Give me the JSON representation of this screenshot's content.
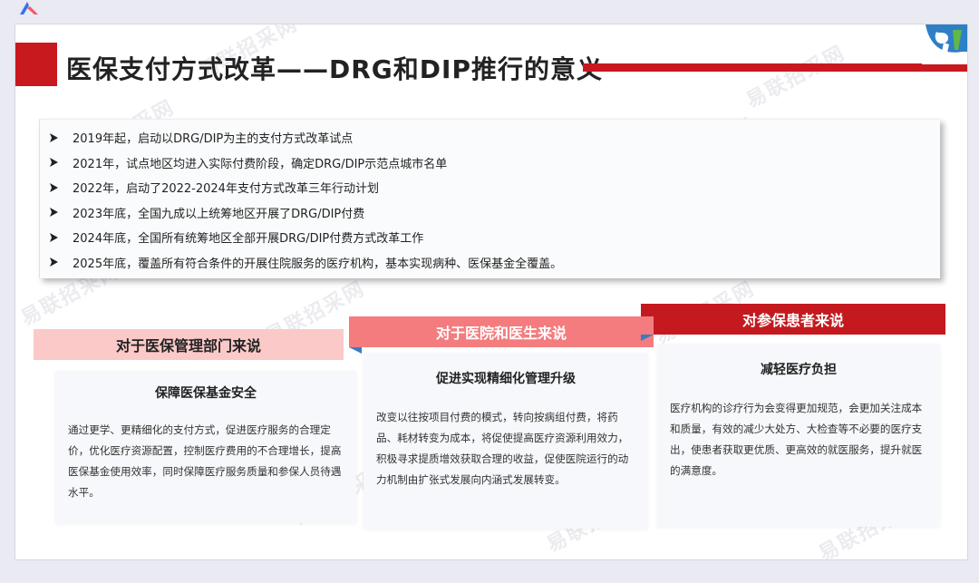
{
  "slide": {
    "title": "医保支付方式改革——DRG和DIP推行的意义",
    "watermark": "易联招采网"
  },
  "timeline": [
    "2019年起，启动以DRG/DIP为主的支付方式改革试点",
    "2021年，试点地区均进入实际付费阶段，确定DRG/DIP示范点城市名单",
    "2022年，启动了2022-2024年支付方式改革三年行动计划",
    "2023年底，全国九成以上统筹地区开展了DRG/DIP付费",
    "2024年底，全国所有统筹地区全部开展DRG/DIP付费方式改革工作",
    "2025年底，覆盖所有符合条件的开展住院服务的医疗机构，基本实现病种、医保基金全覆盖。"
  ],
  "columns": [
    {
      "header": "对于医保管理部门来说",
      "card_title": "保障医保基金安全",
      "card_body": "通过更学、更精细化的支付方式，促进医疗服务的合理定价，优化医疗资源配置，控制医疗费用的不合理增长，提高医保基金使用效率，同时保障医疗服务质量和参保人员待遇水平。"
    },
    {
      "header": "对于医院和医生来说",
      "card_title": "促进实现精细化管理升级",
      "card_body": "改变以往按项目付费的模式，转向按病组付费，将药品、耗材转变为成本，将促使提高医疗资源利用效力，积极寻求提质增效获取合理的收益，促使医院运行的动力机制由扩张式发展向内涵式发展转变。"
    },
    {
      "header": "对参保患者来说",
      "card_title": "减轻医疗负担",
      "card_body": "医疗机构的诊疗行为会变得更加规范，会更加关注成本和质量，有效的减少大处方、大检查等不必要的医疗支出，使患者获取更优质、更高效的就医服务，提升就医的满意度。"
    }
  ],
  "colors": {
    "accent_red": "#c8191f",
    "header_pink_light": "#fbc9c8",
    "header_pink": "#f47c7e",
    "header_red": "#c41a1f",
    "fold_blue": "#3b7bc4"
  }
}
